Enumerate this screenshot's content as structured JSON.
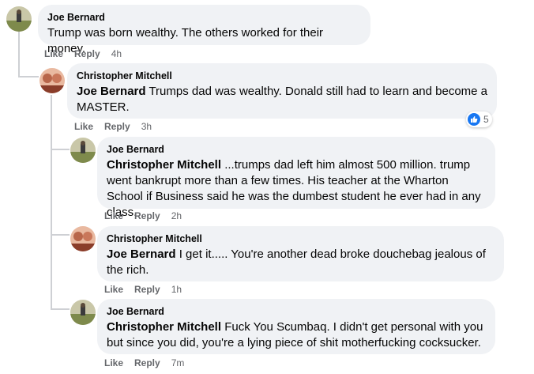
{
  "labels": {
    "like": "Like",
    "reply": "Reply"
  },
  "comments": [
    {
      "author": "Joe Bernard",
      "tag": "",
      "text": "Trump was born wealthy. The others worked for their money.",
      "time": "4h",
      "avatar_icon": "avatar-joe"
    },
    {
      "author": "Christopher Mitchell",
      "tag": "Joe Bernard",
      "text": "Trumps dad was wealthy. Donald still had to learn and become a MASTER.",
      "time": "3h",
      "avatar_icon": "avatar-christopher",
      "reactions": {
        "icon": "thumbs-up-icon",
        "count": "5"
      }
    },
    {
      "author": "Joe Bernard",
      "tag": "Christopher Mitchell",
      "text": "...trumps dad left him almost 500 million. trump went bankrupt more than a few times. His teacher at the Wharton School if Business said he was the dumbest student he ever had in any class.",
      "time": "2h",
      "avatar_icon": "avatar-joe"
    },
    {
      "author": "Christopher Mitchell",
      "tag": "Joe Bernard",
      "text": "I get it..... You're another dead broke douchebag jealous of the rich.",
      "time": "1h",
      "avatar_icon": "avatar-christopher"
    },
    {
      "author": "Joe Bernard",
      "tag": "Christopher Mitchell",
      "text": "Fuck You Scumbaq. I didn't get personal with you but since you did, you're a lying piece of shit motherfucking cocksucker.",
      "time": "7m",
      "avatar_icon": "avatar-joe"
    }
  ],
  "colors": {
    "bubble": "#f0f2f5",
    "meta": "#65676b",
    "like_blue": "#1877f2",
    "thread": "#ced0d4"
  }
}
